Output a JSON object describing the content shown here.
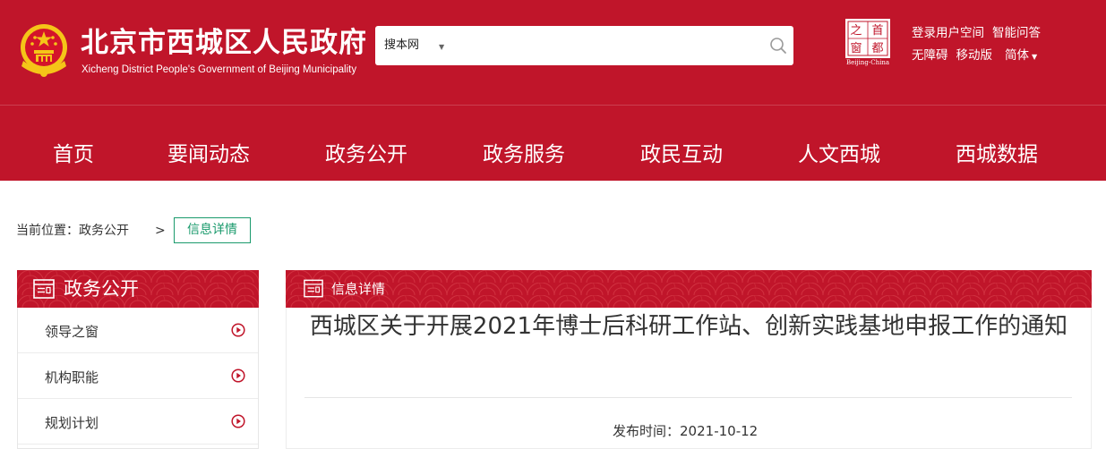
{
  "header": {
    "title": "北京市西城区人民政府",
    "subtitle": "Xicheng District People's Government of Beijing Municipality",
    "search": {
      "scope": "搜本网",
      "placeholder": ""
    },
    "badge": {
      "chars": [
        "之",
        "首",
        "窗",
        "都"
      ],
      "caption": "Beijing-China"
    },
    "links_row1": [
      "登录用户空间",
      "智能问答"
    ],
    "links_row2": [
      "无障碍",
      "移动版",
      "简体"
    ],
    "accent_color": "#c0152a"
  },
  "nav": [
    "首页",
    "要闻动态",
    "政务公开",
    "政务服务",
    "政民互动",
    "人文西城",
    "西城数据"
  ],
  "breadcrumb": {
    "prefix": "当前位置：",
    "parent": "政务公开",
    "separator": ">",
    "current": "信息详情",
    "current_color": "#1a9a6c"
  },
  "sidebar": {
    "title": "政务公开",
    "items": [
      "领导之窗",
      "机构职能",
      "规划计划"
    ]
  },
  "content": {
    "header": "信息详情",
    "article_title": "西城区关于开展2021年博士后科研工作站、创新实践基地申报工作的通知",
    "publish_label": "发布时间：",
    "publish_date": "2021-10-12"
  }
}
